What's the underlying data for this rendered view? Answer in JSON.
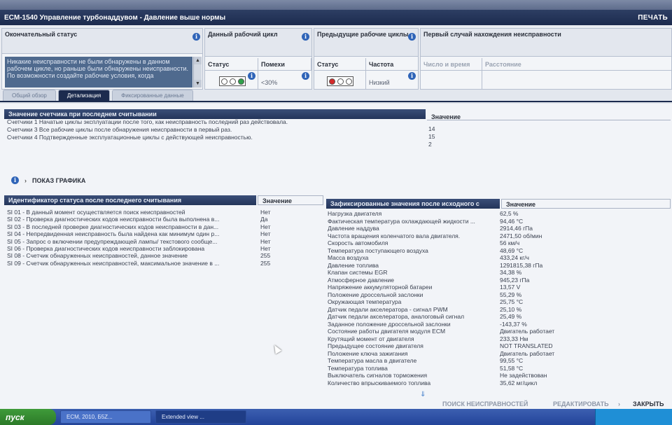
{
  "window": {
    "title": "ECM-1540 Управление турбонаддувом - Давление выше нормы",
    "print_label": "ПЕЧАТЬ"
  },
  "status": {
    "final_status": {
      "label": "Окончательный статус",
      "text": "Никакие неисправности не были обнаружены в данном рабочем цикле, но раньше были обнаружены неисправности. По возможности создайте рабочие условия, когда"
    },
    "current_cycle": {
      "label": "Данный рабочий цикл",
      "status_label": "Статус",
      "noise_label": "Помехи",
      "noise_value": "<30%",
      "lights": [
        "off",
        "off",
        "green"
      ]
    },
    "previous_cycles": {
      "label": "Предыдущие рабочие циклы",
      "status_label": "Статус",
      "frequency_label": "Частота",
      "frequency_value": "Низкий",
      "lights": [
        "red",
        "off",
        "off"
      ]
    },
    "first_detection": {
      "label": "Первый случай нахождения неисправности",
      "number_time_label": "Число и время",
      "distance_label": "Расстояние"
    }
  },
  "tabs": [
    {
      "label": "Общий обзор",
      "active": false
    },
    {
      "label": "Детализация",
      "active": true
    },
    {
      "label": "Фиксированные данные",
      "active": false
    }
  ],
  "counters": {
    "header": "Значение счетчика при последнем считывании",
    "value_header": "Значение",
    "rows": [
      {
        "label": "Счетчики 1 Начатые циклы эксплуатации после того, как неисправность последний раз действовала.",
        "value": "14"
      },
      {
        "label": "Счетчики 3 Все рабочие циклы после обнаружения неисправности в первый раз.",
        "value": "15"
      },
      {
        "label": "Счетчики 4 Подтвержденные эксплуатационные циклы с действующей неисправностью.",
        "value": "2"
      }
    ]
  },
  "graph_label": "ПОКАЗ ГРАФИКА",
  "status_ids": {
    "header": "Идентификатор статуса после последнего считывания",
    "value_header": "Значение",
    "rows": [
      {
        "label": "SI 01 - В данный момент осуществляется поиск неисправностей",
        "value": "Нет"
      },
      {
        "label": "SI 02 - Проверка диагностических кодов неисправности была выполнена в...",
        "value": "Да"
      },
      {
        "label": "SI 03 - В последней проверке диагностических кодов неисправности в дан...",
        "value": "Нет"
      },
      {
        "label": "SI 04 - Непредвиденная неисправность была найдена как минимум один р...",
        "value": "Нет"
      },
      {
        "label": "SI 05 - Запрос о включении предупреждающей лампы/ текстового сообще...",
        "value": "Нет"
      },
      {
        "label": "SI 06 - Проверка диагностических кодов неисправности заблокирована",
        "value": "Нет"
      },
      {
        "label": "SI 08 - Счетчик обнаруженных неисправностей, данное значение",
        "value": "255"
      },
      {
        "label": "SI 09 - Счетчик обнаруженных неисправностей, максимальное значение в ...",
        "value": "255"
      }
    ]
  },
  "frozen": {
    "header": "Зафиксированные значения после исходного с",
    "value_header": "Значение",
    "rows": [
      {
        "label": "Нагрузка двигателя",
        "value": "62,5 %"
      },
      {
        "label": "Фактическая температура охлаждающей жидкости ...",
        "value": "94,46 °C"
      },
      {
        "label": "Давление наддува",
        "value": "2914,46 гПа"
      },
      {
        "label": "Частота вращения коленчатого вала двигателя.",
        "value": "2471,50 об/мин"
      },
      {
        "label": "Скорость автомобиля",
        "value": "56 км/ч"
      },
      {
        "label": "Температура поступающего воздуха",
        "value": "48,69 °C"
      },
      {
        "label": "Масса воздуха",
        "value": "433,24 кг/ч"
      },
      {
        "label": "Давление топлива",
        "value": "1291815,38 гПа"
      },
      {
        "label": "Клапан системы EGR",
        "value": "34,38 %"
      },
      {
        "label": "Атмосферное давление",
        "value": "945,23 гПа"
      },
      {
        "label": "Напряжение аккумуляторной батареи",
        "value": "13,57 V"
      },
      {
        "label": "Положение дроссельной заслонки",
        "value": "55,29 %"
      },
      {
        "label": "Окружающая температура",
        "value": "25,75 °C"
      },
      {
        "label": "Датчик педали акселератора - сигнал PWM",
        "value": "25,10 %"
      },
      {
        "label": "Датчик педали акселератора, аналоговый сигнал",
        "value": "25,49 %"
      },
      {
        "label": "Заданное положение дроссельной заслонки",
        "value": "-143,37 %"
      },
      {
        "label": "Состояние работы двигателя модуля ECM",
        "value": "Двигатель работает"
      },
      {
        "label": "Крутящий момент от двигателя",
        "value": "233,33 Нм"
      },
      {
        "label": "Предыдущее состояние двигателя",
        "value": "NOT TRANSLATED"
      },
      {
        "label": "Положение ключа зажигания",
        "value": "Двигатель работает"
      },
      {
        "label": "Температура масла в двигателе",
        "value": "99,55 °C"
      },
      {
        "label": "Температура топлива",
        "value": "51,58 °C"
      },
      {
        "label": "Выключатель сигналов торможения",
        "value": "Не задействован"
      },
      {
        "label": "Количество впрыскиваемого топлива",
        "value": "35,62 мг/цикл"
      }
    ]
  },
  "footer": {
    "search": "ПОИСК НЕИСПРАВНОСТЕЙ",
    "edit": "РЕДАКТИРОВАТЬ",
    "close": "ЗАКРЫТЬ"
  },
  "taskbar": {
    "start": "пуск",
    "tasks": [
      "ECM, 2010, Б5Z...",
      "Extended view ..."
    ]
  }
}
